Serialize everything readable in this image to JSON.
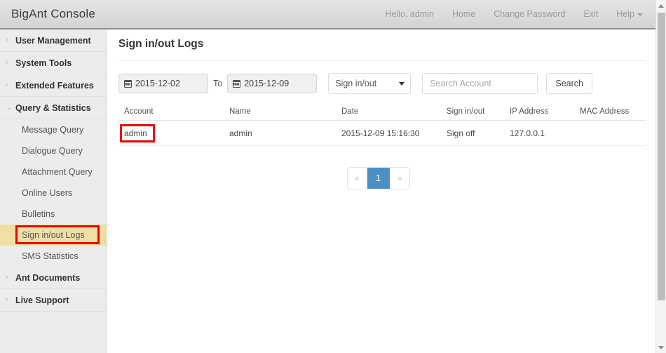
{
  "header": {
    "brand": "BigAnt Console",
    "nav": [
      {
        "label": "Hello, admin",
        "name": "greeting"
      },
      {
        "label": "Home",
        "name": "home"
      },
      {
        "label": "Change Password",
        "name": "change-password"
      },
      {
        "label": "Exit",
        "name": "exit"
      },
      {
        "label": "Help",
        "name": "help",
        "caret": true
      }
    ]
  },
  "sidebar": {
    "groups": [
      {
        "label": "User Management",
        "chevron": "›",
        "expanded": false
      },
      {
        "label": "System Tools",
        "chevron": "›",
        "expanded": false
      },
      {
        "label": "Extended Features",
        "chevron": "›",
        "expanded": false
      },
      {
        "label": "Query & Statistics",
        "chevron": "⌄",
        "expanded": true
      }
    ],
    "sub_items": [
      {
        "label": "Message Query",
        "active": false
      },
      {
        "label": "Dialogue Query",
        "active": false
      },
      {
        "label": "Attachment Query",
        "active": false
      },
      {
        "label": "Online Users",
        "active": false
      },
      {
        "label": "Bulletins",
        "active": false
      },
      {
        "label": "Sign in/out Logs",
        "active": true
      },
      {
        "label": "SMS Statistics",
        "active": false
      }
    ],
    "trailing_groups": [
      {
        "label": "Ant Documents",
        "chevron": "›",
        "expanded": false
      },
      {
        "label": "Live Support",
        "chevron": "›",
        "expanded": false
      }
    ],
    "active_highlight_color": "#f0dfa4",
    "annotation_color": "#ee0000"
  },
  "main": {
    "page_title": "Sign in/out Logs",
    "filters": {
      "date_from": "2015-12-02",
      "to_label": "To",
      "date_to": "2015-12-09",
      "type_select": "Sign in/out",
      "search_value": "",
      "search_placeholder": "Search Account",
      "search_button": "Search"
    },
    "table": {
      "columns": [
        "Account",
        "Name",
        "Date",
        "Sign in/out",
        "IP Address",
        "MAC Address"
      ],
      "rows": [
        {
          "account": "admin",
          "name": "admin",
          "date": "2015-12-09 15:16:30",
          "sign_in_out": "Sign off",
          "ip_address": "127.0.0.1",
          "mac_address": ""
        }
      ]
    },
    "pagination": {
      "prev": "«",
      "pages": [
        "1"
      ],
      "next": "»",
      "current": "1",
      "active_color": "#4a90c7"
    }
  }
}
